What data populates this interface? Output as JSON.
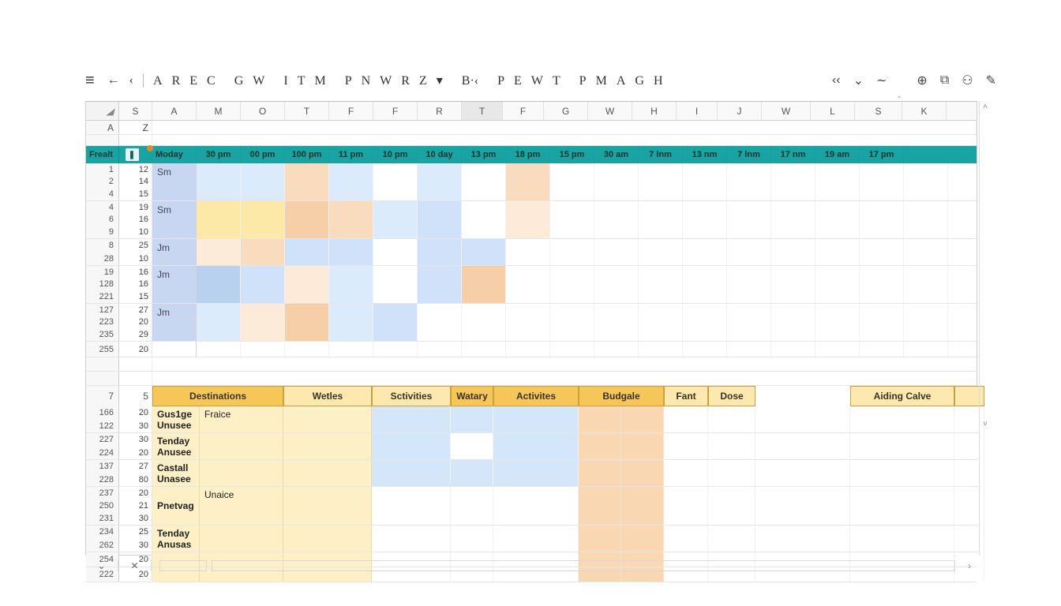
{
  "toolbar": {
    "left_groups": [
      [
        "A",
        "R",
        "E",
        "C"
      ],
      [
        "G",
        "W"
      ],
      [
        "I",
        "T",
        "M"
      ],
      [
        "P",
        "N",
        "W",
        "R",
        "Z"
      ],
      [
        "B·‹"
      ],
      [
        "P",
        "E",
        "W",
        "T"
      ],
      [
        "P",
        "M",
        "A",
        "G",
        "H"
      ]
    ],
    "dropdown_caret": "▾",
    "right_icons": {
      "rewind": "‹‹",
      "caret": "⌄",
      "ellipsis": "∼",
      "help": "⊕",
      "copy": "⧉",
      "user": "⚇",
      "share": "✎"
    }
  },
  "column_headers": [
    "S",
    "A",
    "M",
    "O",
    "T",
    "F",
    "F",
    "R",
    "T",
    "F",
    "G",
    "W",
    "H",
    "I",
    "J",
    "W",
    "L",
    "S",
    "K"
  ],
  "name_box_row": {
    "rownum": "A",
    "colS": "Z"
  },
  "schedule_header": {
    "row_label": "Frealt",
    "icon": "❚",
    "day": "Moday",
    "times": [
      "30 pm",
      "00 pm",
      "100 pm",
      "11 pm",
      "10 pm",
      "10 day",
      "13 pm",
      "18 pm",
      "15 pm",
      "30 am",
      "7 lnm",
      "13 nm",
      "7 lnm",
      "17 nm",
      "19 am",
      "17 pm"
    ]
  },
  "schedule_rows": [
    {
      "rownums": [
        "1",
        "2",
        "4"
      ],
      "s": [
        "12",
        "14",
        "15"
      ],
      "label": "Sm",
      "cells": [
        "blue3",
        "blue3",
        "orange2",
        "blue3",
        "",
        "blue3",
        "",
        "orange2",
        "",
        "",
        "",
        "",
        "",
        "",
        "",
        "",
        ""
      ]
    },
    {
      "rownums": [
        "4",
        "6",
        "9"
      ],
      "s": [
        "19",
        "16",
        "10"
      ],
      "label": "Sm",
      "cells": [
        "yellow1",
        "yellow1",
        "orange1",
        "orange2",
        "blue3",
        "blue2",
        "",
        "peach2",
        "",
        "",
        "",
        "",
        "",
        "",
        "",
        "",
        ""
      ]
    },
    {
      "rownums": [
        "8",
        "28"
      ],
      "s": [
        "25",
        "10"
      ],
      "label": "Jm",
      "cells": [
        "peach2",
        "orange2",
        "blue2",
        "blue2",
        "",
        "blue2",
        "blue2",
        "",
        "",
        "",
        "",
        "",
        "",
        "",
        "",
        "",
        ""
      ]
    },
    {
      "rownums": [
        "19",
        "128",
        "221"
      ],
      "s": [
        "16",
        "16",
        "15"
      ],
      "label": "Jm",
      "cells": [
        "blue1",
        "blue2",
        "peach2",
        "blue3",
        "",
        "blue2",
        "orange1",
        "",
        "",
        "",
        "",
        "",
        "",
        "",
        "",
        "",
        ""
      ]
    },
    {
      "rownums": [
        "127",
        "223",
        "235"
      ],
      "s": [
        "27",
        "20",
        "29"
      ],
      "label": "Jm",
      "cells": [
        "blue3",
        "peach2",
        "orange1",
        "blue3",
        "blue2",
        "",
        "",
        "",
        "",
        "",
        "",
        "",
        "",
        "",
        "",
        "",
        ""
      ]
    },
    {
      "rownums": [
        "255"
      ],
      "s": [
        "20"
      ],
      "label": "",
      "cells": [
        "",
        "",
        "",
        "",
        "",
        "",
        "",
        "",
        "",
        "",
        "",
        "",
        "",
        "",
        "",
        "",
        ""
      ]
    }
  ],
  "dest_header": {
    "rownum": "7",
    "s": "5",
    "cols": [
      "Destinations",
      "Wetles",
      "Sctivities",
      "Watary",
      "Activites",
      "Budgale",
      "Fant",
      "Dose",
      "",
      "Aiding Calve",
      ""
    ]
  },
  "dest_rows": [
    {
      "rownums": [
        "166",
        "122"
      ],
      "s": [
        "20",
        "30"
      ],
      "name": "Gus1ge",
      "sub": "Unusee",
      "col2": "Fraice",
      "blue_cols": 4,
      "wat_white": false
    },
    {
      "rownums": [
        "227",
        "224"
      ],
      "s": [
        "30",
        "20"
      ],
      "name": "Tenday",
      "sub": "Anusee",
      "col2": "",
      "blue_cols": 4,
      "wat_white": true
    },
    {
      "rownums": [
        "137",
        "228"
      ],
      "s": [
        "27",
        "80"
      ],
      "name": "Castall",
      "sub": "Unasee",
      "col2": "",
      "blue_cols": 4,
      "wat_white": false
    },
    {
      "rownums": [
        "237",
        "250",
        "231"
      ],
      "s": [
        "20",
        "21",
        "30"
      ],
      "name": "Pnetvag",
      "sub": "",
      "col2": "Unaice",
      "blue_cols": 0,
      "wat_white": false
    },
    {
      "rownums": [
        "234",
        "262"
      ],
      "s": [
        "25",
        "30"
      ],
      "name": "Tenday",
      "sub": "Anusas",
      "col2": "",
      "blue_cols": 0,
      "wat_white": false
    },
    {
      "rownums": [
        "254"
      ],
      "s": [
        "20"
      ],
      "name": "",
      "sub": "",
      "col2": "",
      "blue_cols": 0,
      "wat_white": false
    },
    {
      "rownums": [
        "222"
      ],
      "s": [
        "20"
      ],
      "name": "",
      "sub": "",
      "col2": "",
      "blue_cols": 0,
      "wat_white": false
    }
  ],
  "footer": {
    "close": "✕",
    "back": "⌄",
    "forward": "›"
  }
}
